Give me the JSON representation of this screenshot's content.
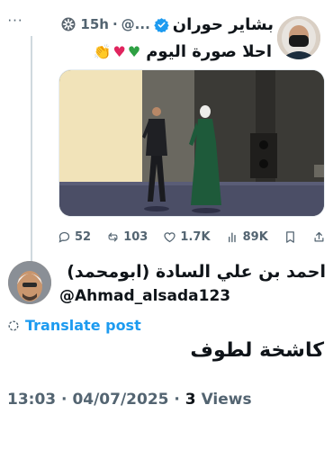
{
  "parent_tweet": {
    "more_label": "···",
    "display_name": "بشاير حوران",
    "handle": "@...",
    "separator": "·",
    "time": "15h",
    "text": "احلا صورة اليوم",
    "emoji_icons": [
      "clapping-hands-icon",
      "red-heart-icon",
      "green-heart-icon"
    ],
    "actions": {
      "replies": "52",
      "reposts": "103",
      "likes": "1.7K",
      "views": "89K"
    }
  },
  "reply": {
    "display_name": "احمد بن علي السادة (ابومحمد)",
    "handle": "@Ahmad_alsada123",
    "translate_label": "Translate post",
    "text": "كاشخة لطوف",
    "time": "13:03",
    "date": "04/07/2025",
    "views_count": "3",
    "views_label": "Views",
    "separator": "·"
  },
  "colors": {
    "accent": "#1d9bf0",
    "muted": "#536471",
    "text": "#0f1419",
    "thread_line": "#cfd9de"
  }
}
